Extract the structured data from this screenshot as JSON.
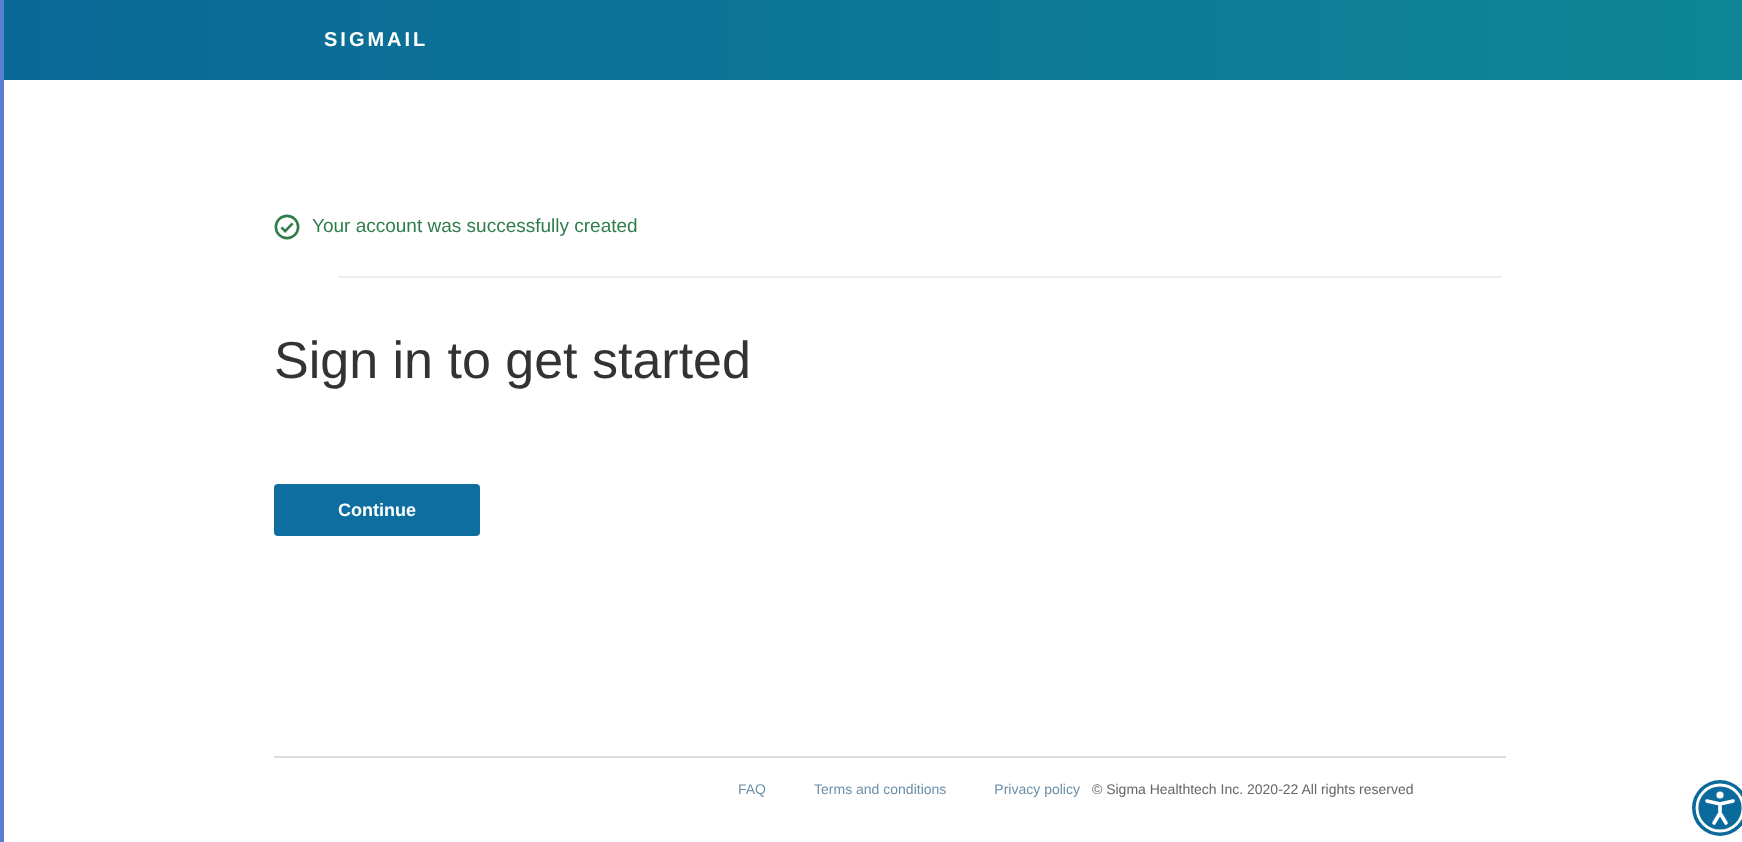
{
  "header": {
    "logo": "SIGMAIL"
  },
  "notice": {
    "text": "Your account was successfully created"
  },
  "heading": "Sign in to get started",
  "buttons": [
    "Continue"
  ],
  "footer": {
    "links": [
      "FAQ",
      "Terms and conditions",
      "Privacy policy"
    ],
    "copyright": "© Sigma Healthtech Inc. 2020-22 All rights reserved"
  }
}
